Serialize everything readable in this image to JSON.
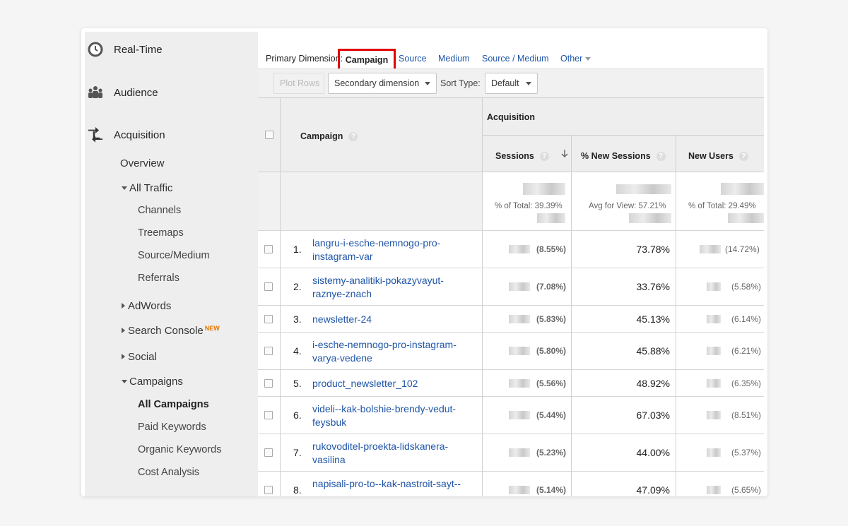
{
  "sidebar": {
    "realtime": "Real-Time",
    "audience": "Audience",
    "acquisition": "Acquisition",
    "overview": "Overview",
    "all_traffic": "All Traffic",
    "channels": "Channels",
    "treemaps": "Treemaps",
    "source_medium": "Source/Medium",
    "referrals": "Referrals",
    "adwords": "AdWords",
    "search_console": "Search Console",
    "new_badge": "NEW",
    "social": "Social",
    "campaigns": "Campaigns",
    "all_campaigns": "All Campaigns",
    "paid_keywords": "Paid Keywords",
    "organic_keywords": "Organic Keywords",
    "cost_analysis": "Cost Analysis"
  },
  "primary_dimension": {
    "label": "Primary Dimension:",
    "selected": "Campaign",
    "options": [
      "Source",
      "Medium",
      "Source / Medium",
      "Other"
    ]
  },
  "toolbar": {
    "plot_rows": "Plot Rows",
    "secondary_dimension": "Secondary dimension",
    "sort_type_label": "Sort Type:",
    "sort_type_value": "Default"
  },
  "table": {
    "campaign_header": "Campaign",
    "group_header": "Acquisition",
    "col_sessions": "Sessions",
    "col_new_sessions": "% New Sessions",
    "col_new_users": "New Users",
    "totals": {
      "sessions": "% of Total: 39.39%",
      "new_sessions": "Avg for View: 57.21%",
      "new_users": "% of Total: 29.49%"
    },
    "rows": [
      {
        "num": "1.",
        "campaign": "langru-i-esche-nemnogo-pro-instagram-var",
        "sessions_pct": "(8.55%)",
        "new_sessions": "73.78%",
        "new_users_pct": "(14.72%)"
      },
      {
        "num": "2.",
        "campaign": "sistemy-analitiki-pokazyvayut-raznye-znach",
        "sessions_pct": "(7.08%)",
        "new_sessions": "33.76%",
        "new_users_pct": "(5.58%)"
      },
      {
        "num": "3.",
        "campaign": "newsletter-24",
        "sessions_pct": "(5.83%)",
        "new_sessions": "45.13%",
        "new_users_pct": "(6.14%)"
      },
      {
        "num": "4.",
        "campaign": "i-esche-nemnogo-pro-instagram-varya-vedene",
        "sessions_pct": "(5.80%)",
        "new_sessions": "45.88%",
        "new_users_pct": "(6.21%)"
      },
      {
        "num": "5.",
        "campaign": "product_newsletter_102",
        "sessions_pct": "(5.56%)",
        "new_sessions": "48.92%",
        "new_users_pct": "(6.35%)"
      },
      {
        "num": "6.",
        "campaign": "videli--kak-bolshie-brendy-vedut-feysbuk",
        "sessions_pct": "(5.44%)",
        "new_sessions": "67.03%",
        "new_users_pct": "(8.51%)"
      },
      {
        "num": "7.",
        "campaign": "rukovoditel-proekta-lidskanera-vasilina",
        "sessions_pct": "(5.23%)",
        "new_sessions": "44.00%",
        "new_users_pct": "(5.37%)"
      },
      {
        "num": "8.",
        "campaign": "napisali-pro-to--kak-nastroit-sayt--",
        "sessions_pct": "(5.14%)",
        "new_sessions": "47.09%",
        "new_users_pct": "(5.65%)"
      }
    ]
  }
}
